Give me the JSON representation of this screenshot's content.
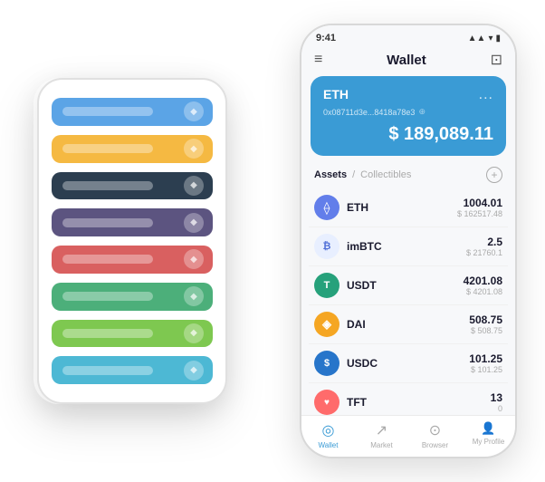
{
  "scene": {
    "back_phone": {
      "cards": [
        {
          "color": "card-blue",
          "icon": "◆"
        },
        {
          "color": "card-yellow",
          "icon": "◆"
        },
        {
          "color": "card-dark",
          "icon": "◆"
        },
        {
          "color": "card-purple",
          "icon": "◆"
        },
        {
          "color": "card-red",
          "icon": "◆"
        },
        {
          "color": "card-green",
          "icon": "◆"
        },
        {
          "color": "card-light-green",
          "icon": "◆"
        },
        {
          "color": "card-sky",
          "icon": "◆"
        }
      ]
    },
    "front_phone": {
      "status_bar": {
        "time": "9:41",
        "icons": "▲▲ ◀"
      },
      "header": {
        "title": "Wallet",
        "menu_icon": "≡",
        "scan_icon": "⊡"
      },
      "eth_card": {
        "label": "ETH",
        "more": "...",
        "address": "0x08711d3e...8418a78e3",
        "copy_icon": "⊕",
        "balance": "$ 189,089.11"
      },
      "assets_section": {
        "tab_active": "Assets",
        "separator": "/",
        "tab_inactive": "Collectibles",
        "add_icon": "+"
      },
      "assets": [
        {
          "icon": "⟠",
          "icon_class": "asset-icon-eth",
          "name": "ETH",
          "amount": "1004.01",
          "usd": "$ 162517.48"
        },
        {
          "icon": "₿",
          "icon_class": "asset-icon-imbtc",
          "name": "imBTC",
          "amount": "2.5",
          "usd": "$ 21760.1"
        },
        {
          "icon": "T",
          "icon_class": "asset-icon-usdt",
          "name": "USDT",
          "amount": "4201.08",
          "usd": "$ 4201.08"
        },
        {
          "icon": "◈",
          "icon_class": "asset-icon-dai",
          "name": "DAI",
          "amount": "508.75",
          "usd": "$ 508.75"
        },
        {
          "icon": "$",
          "icon_class": "asset-icon-usdc",
          "name": "USDC",
          "amount": "101.25",
          "usd": "$ 101.25"
        },
        {
          "icon": "♥",
          "icon_class": "asset-icon-tft",
          "name": "TFT",
          "amount": "13",
          "usd": "0"
        }
      ],
      "bottom_nav": [
        {
          "label": "Wallet",
          "icon": "◎",
          "active": true
        },
        {
          "label": "Market",
          "icon": "↗",
          "active": false
        },
        {
          "label": "Browser",
          "icon": "⊙",
          "active": false
        },
        {
          "label": "My Profile",
          "icon": "👤",
          "active": false
        }
      ]
    }
  }
}
